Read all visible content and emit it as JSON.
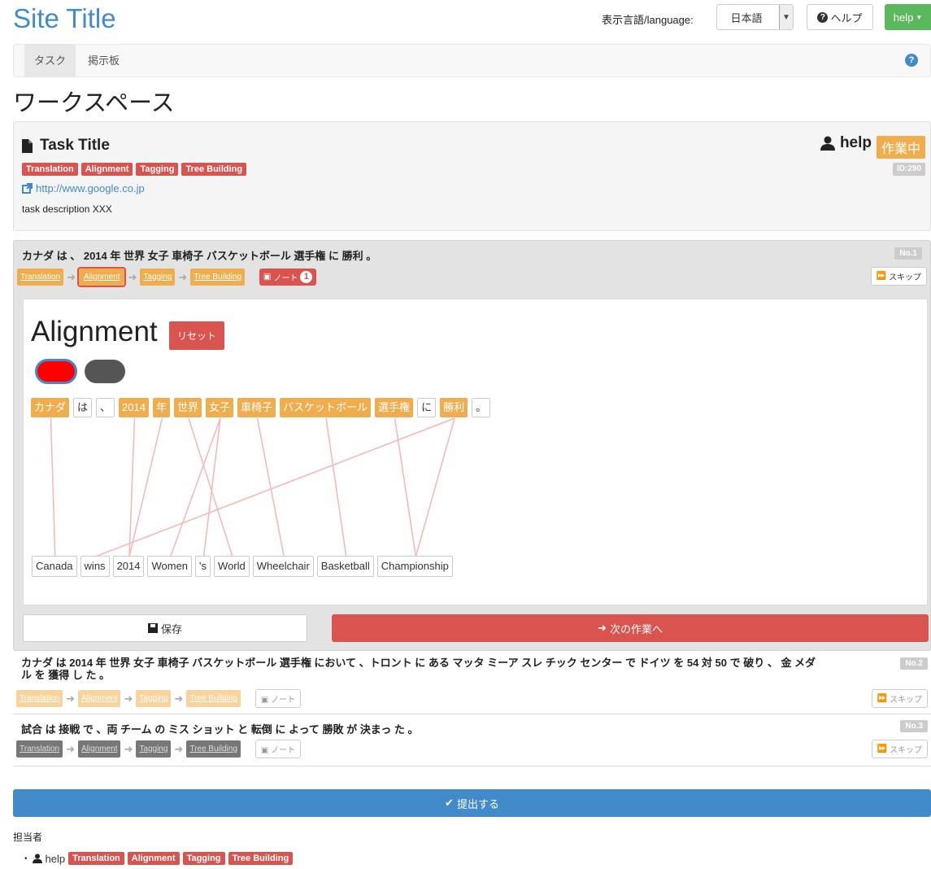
{
  "header": {
    "site_title": "Site Title",
    "language_label": "表示言語/language:",
    "language_value": "日本語",
    "help_label": "ヘルプ",
    "user_label": "help"
  },
  "nav": {
    "tabs": [
      "タスク",
      "掲示板"
    ]
  },
  "page_title": "ワークスペース",
  "task": {
    "title": "Task Title",
    "labels": [
      "Translation",
      "Alignment",
      "Tagging",
      "Tree Building"
    ],
    "link": "http://www.google.co.jp",
    "description": "task description XXX",
    "assignee": "help",
    "status": "作業中",
    "id": "ID:290"
  },
  "steps": [
    "Translation",
    "Alignment",
    "Tagging",
    "Tree Building"
  ],
  "note_label": "ノート",
  "skip_label": "スキップ",
  "sentences": [
    {
      "text": "カナダ は 、 2014 年 世界 女子 車椅子 バスケットボール 選手権 に 勝利 。",
      "no": "No.1",
      "note_count": "1"
    },
    {
      "text_line1": "カナダ は 2014 年 世界 女子 車椅子 バスケットボール 選手権 において 、トロント に ある マッタ ミーア スレ チック センター で ドイツ を 54 対 50 で 破り 、 金 メダ",
      "text_line2": "ル を 獲得 し た 。",
      "no": "No.2"
    },
    {
      "text": "試合 は 接戦 で 、両 チーム の ミス ショット と 転倒 に よって 勝敗 が 決まっ た 。",
      "no": "No.3"
    }
  ],
  "alignment": {
    "title": "Alignment",
    "reset_label": "リセット",
    "source_tokens": [
      "カナダ",
      "は",
      "、",
      "2014",
      "年",
      "世界",
      "女子",
      "車椅子",
      "バスケットボール",
      "選手権",
      "に",
      "勝利",
      "。"
    ],
    "target_tokens": [
      "Canada",
      "wins",
      "2014",
      "Women",
      "'s",
      "World",
      "Wheelchair",
      "Basketball",
      "Championship"
    ],
    "links": [
      [
        0,
        0
      ],
      [
        3,
        2
      ],
      [
        4,
        2
      ],
      [
        5,
        5
      ],
      [
        6,
        3
      ],
      [
        6,
        4
      ],
      [
        7,
        6
      ],
      [
        8,
        7
      ],
      [
        9,
        8
      ],
      [
        11,
        1
      ],
      [
        11,
        8
      ]
    ]
  },
  "actions": {
    "save_label": "保存",
    "next_label": "次の作業へ",
    "submit_label": "提出する"
  },
  "assignees": {
    "heading": "担当者",
    "user": "help",
    "labels": [
      "Translation",
      "Alignment",
      "Tagging",
      "Tree Building"
    ]
  },
  "colors": {
    "accent": "#428bca",
    "danger": "#d9534f",
    "warning": "#f0ad4e",
    "success": "#5cb85c"
  }
}
